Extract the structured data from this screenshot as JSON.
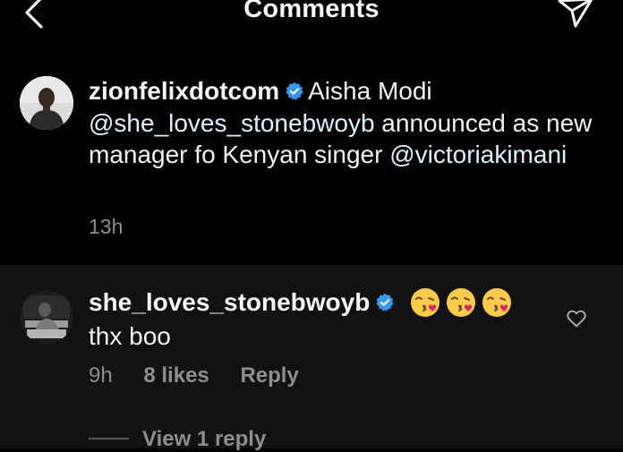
{
  "header": {
    "title": "Comments",
    "back_icon": "chevron-left-icon",
    "share_icon": "paper-plane-icon"
  },
  "caption": {
    "username": "zionfelixdotcom",
    "verified": true,
    "text_part1": "Aisha Modi",
    "mention1": "@she_loves_stonebwoyb",
    "text_part2": "announced as new manager fo Kenyan singer",
    "mention2": "@victoriakimani",
    "time": "13h"
  },
  "comment": {
    "username": "she_loves_stonebwoyb",
    "verified": true,
    "emojis": [
      "kissing-heart-emoji",
      "kissing-heart-emoji",
      "kissing-heart-emoji"
    ],
    "text": "thx boo",
    "time": "9h",
    "likes": "8 likes",
    "reply_label": "Reply",
    "view_replies_label": "View 1 reply"
  },
  "colors": {
    "background": "#000000",
    "comment_background": "#121212",
    "secondary_text": "#8e8e8e",
    "verified_blue": "#3897f0"
  }
}
